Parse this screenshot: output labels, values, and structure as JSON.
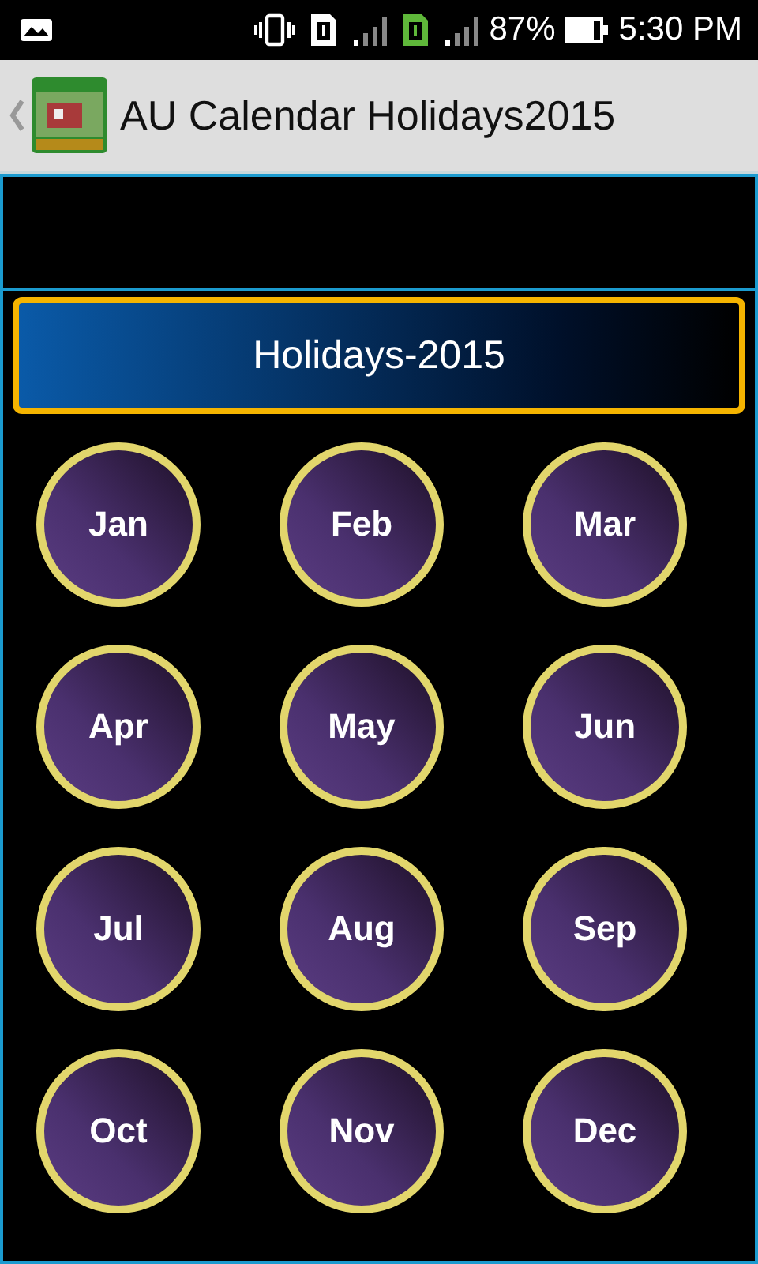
{
  "status_bar": {
    "battery": "87%",
    "time": "5:30 PM"
  },
  "app_bar": {
    "title": "AU Calendar Holidays2015"
  },
  "header": {
    "title": "Holidays-2015"
  },
  "months": [
    {
      "label": "Jan"
    },
    {
      "label": "Feb"
    },
    {
      "label": "Mar"
    },
    {
      "label": "Apr"
    },
    {
      "label": "May"
    },
    {
      "label": "Jun"
    },
    {
      "label": "Jul"
    },
    {
      "label": "Aug"
    },
    {
      "label": "Sep"
    },
    {
      "label": "Oct"
    },
    {
      "label": "Nov"
    },
    {
      "label": "Dec"
    }
  ]
}
